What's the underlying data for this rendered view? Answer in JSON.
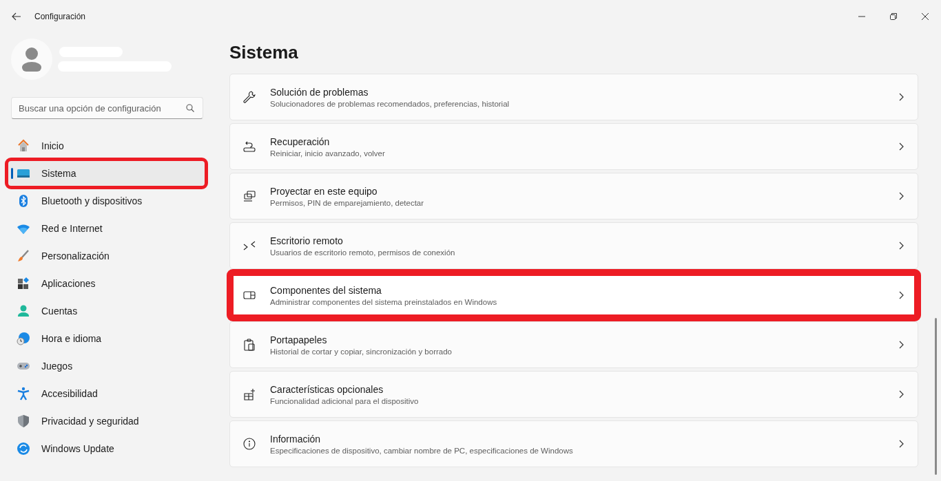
{
  "window": {
    "title": "Configuración"
  },
  "search": {
    "placeholder": "Buscar una opción de configuración"
  },
  "nav": [
    {
      "label": "Inicio",
      "selected": false,
      "highlighted": false
    },
    {
      "label": "Sistema",
      "selected": true,
      "highlighted": true
    },
    {
      "label": "Bluetooth y dispositivos",
      "selected": false,
      "highlighted": false
    },
    {
      "label": "Red e Internet",
      "selected": false,
      "highlighted": false
    },
    {
      "label": "Personalización",
      "selected": false,
      "highlighted": false
    },
    {
      "label": "Aplicaciones",
      "selected": false,
      "highlighted": false
    },
    {
      "label": "Cuentas",
      "selected": false,
      "highlighted": false
    },
    {
      "label": "Hora e idioma",
      "selected": false,
      "highlighted": false
    },
    {
      "label": "Juegos",
      "selected": false,
      "highlighted": false
    },
    {
      "label": "Accesibilidad",
      "selected": false,
      "highlighted": false
    },
    {
      "label": "Privacidad y seguridad",
      "selected": false,
      "highlighted": false
    },
    {
      "label": "Windows Update",
      "selected": false,
      "highlighted": false
    }
  ],
  "page_title": "Sistema",
  "settings": [
    {
      "title": "Solución de problemas",
      "description": "Solucionadores de problemas recomendados, preferencias, historial",
      "highlighted": false
    },
    {
      "title": "Recuperación",
      "description": "Reiniciar, inicio avanzado, volver",
      "highlighted": false
    },
    {
      "title": "Proyectar en este equipo",
      "description": "Permisos, PIN de emparejamiento, detectar",
      "highlighted": false
    },
    {
      "title": "Escritorio remoto",
      "description": "Usuarios de escritorio remoto, permisos de conexión",
      "highlighted": false
    },
    {
      "title": "Componentes del sistema",
      "description": "Administrar componentes del sistema preinstalados en Windows",
      "highlighted": true
    },
    {
      "title": "Portapapeles",
      "description": "Historial de cortar y copiar, sincronización y borrado",
      "highlighted": false
    },
    {
      "title": "Características opcionales",
      "description": "Funcionalidad adicional para el dispositivo",
      "highlighted": false
    },
    {
      "title": "Información",
      "description": "Especificaciones de dispositivo, cambiar nombre de PC, especificaciones de Windows",
      "highlighted": false
    }
  ]
}
